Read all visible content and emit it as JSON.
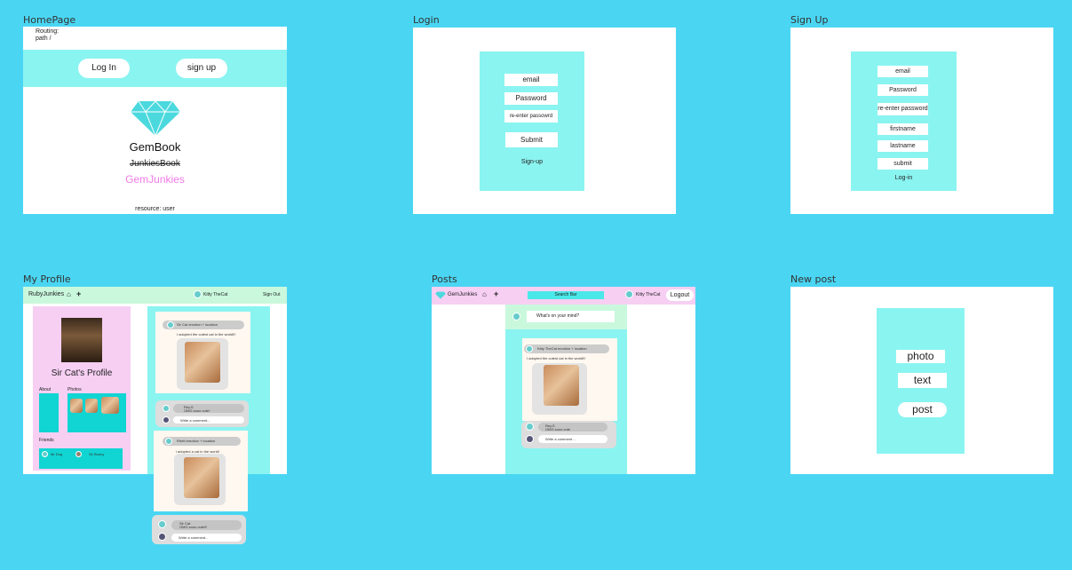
{
  "labels": {
    "home": "HomePage",
    "login": "Login",
    "signup": "Sign Up",
    "profile": "My Profile",
    "posts": "Posts",
    "newpost": "New post"
  },
  "home": {
    "routing": "Routing:",
    "path": "path /",
    "login_btn": "Log In",
    "signup_btn": "sign up",
    "title": "GemBook",
    "struck": "JunkiesBook",
    "subtitle": "GemJunkies",
    "resource": "resource: user"
  },
  "login": {
    "email": "email",
    "password": "Password",
    "reenter": "re-enter passowrd",
    "submit": "Submit",
    "signup_link": "Sign-up"
  },
  "signup": {
    "email": "email",
    "password": "Password",
    "reenter": "re-enter password",
    "firstname": "firstname",
    "lastname": "lastname",
    "submit": "submit",
    "login_link": "Log-in"
  },
  "profile": {
    "brand": "RubyJunkies",
    "user": "Kitty TheCat",
    "signout": "Sign Out",
    "title": "Sir Cat's Profile",
    "about": "About",
    "photos": "Photos",
    "friends": "Friends",
    "friend1": "Mr Dog",
    "friend2": "Sir Bunny",
    "post1_header": "Sir Cat emotion + location",
    "post1_text": "I adopted the cutest cat in the world!!!",
    "comment_name": "Rey.S",
    "comment_text": "OMG sooo cute!",
    "write_comment": "Write a comment...",
    "post2_header": "Rhett emotion + location",
    "post2_text": "i adopted a cat in the world!",
    "comment2_name": "Sir Cat",
    "comment2_text": "OMG sooo cute!!!",
    "write_comment2": "Write a comment..."
  },
  "posts": {
    "brand": "GemJunkies",
    "search": "Search Bar",
    "user": "Kitty TheCat",
    "logout": "Logout",
    "whats_on_mind": "What's on your mind?",
    "post_header": "Kitty TheCat emotion + location",
    "post_text": "I adopted the cutest cat in the world!!!",
    "comment_name": "Rey.S",
    "comment_text": "OMG sooo cute",
    "write_comment": "Write a comment ..."
  },
  "newpost": {
    "photo": "photo",
    "text": "text",
    "post": "post"
  }
}
